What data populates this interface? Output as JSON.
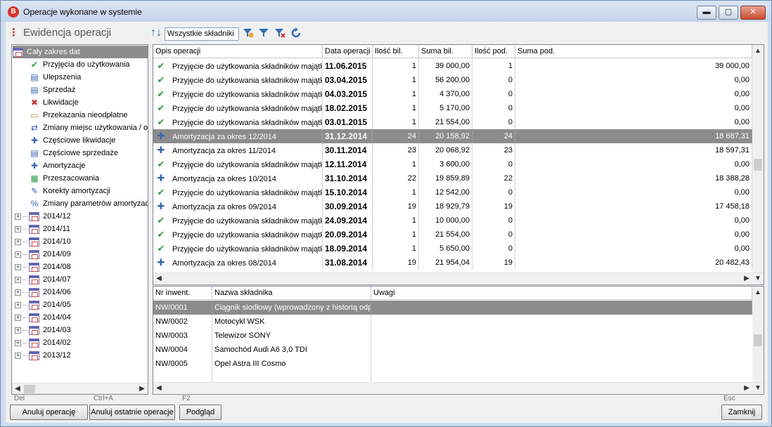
{
  "window": {
    "title": "Operacje wykonane w systemie",
    "app_badge": "B",
    "controls": {
      "minimize": "▬",
      "maximize": "▢",
      "close": "✕"
    }
  },
  "module": {
    "dots": "⋮",
    "title": "Ewidencja operacji"
  },
  "toolbar": {
    "sort_icon": "↑↓",
    "filter_value": "Wszystkie składniki",
    "icons": [
      "filter-settings-icon",
      "filter-icon",
      "filter-clear-icon",
      "refresh-icon"
    ]
  },
  "tree": {
    "root": "Cały zakres dat",
    "operations": [
      {
        "label": "Przyjęcia do użytkowania",
        "icon": "✔",
        "color": "#2e9b48"
      },
      {
        "label": "Ulepszenia",
        "icon": "▤",
        "color": "#3565b5"
      },
      {
        "label": "Sprzedaż",
        "icon": "▤",
        "color": "#3565b5"
      },
      {
        "label": "Likwidacje",
        "icon": "✖",
        "color": "#c9372c"
      },
      {
        "label": "Przekazania nieodpłatne",
        "icon": "▭",
        "color": "#c08a2a"
      },
      {
        "label": "Zmiany miejsc użytkowania / o",
        "icon": "⇄",
        "color": "#3565b5"
      },
      {
        "label": "Częściowe likwidacje",
        "icon": "✚",
        "color": "#3565b5"
      },
      {
        "label": "Częściowe sprzedaże",
        "icon": "▤",
        "color": "#3565b5"
      },
      {
        "label": "Amortyzacje",
        "icon": "✚",
        "color": "#3565b5"
      },
      {
        "label": "Przeszacowania",
        "icon": "▦",
        "color": "#2e9b48"
      },
      {
        "label": "Korekty amortyzacji",
        "icon": "✎",
        "color": "#3565b5"
      },
      {
        "label": "Zmiany parametrów amortyzacji",
        "icon": "%",
        "color": "#3565b5"
      }
    ],
    "periods": [
      "2014/12",
      "2014/11",
      "2014/10",
      "2014/09",
      "2014/08",
      "2014/07",
      "2014/06",
      "2014/05",
      "2014/04",
      "2014/03",
      "2014/02",
      "2013/12"
    ]
  },
  "ops_grid": {
    "headers": [
      "Opis operacji",
      "Data operacji",
      "Ilość bil.",
      "Suma bil.",
      "Ilość pod.",
      "Suma pod."
    ],
    "rows": [
      {
        "type": "check",
        "desc": "Przyjęcie do użytkowania składników majątku",
        "date": "11.06.2015",
        "qty_bil": "1",
        "sum_bil": "39 000,00",
        "qty_pod": "1",
        "sum_pod": "39 000,00"
      },
      {
        "type": "check",
        "desc": "Przyjęcie do użytkowania składników majątku",
        "date": "03.04.2015",
        "qty_bil": "1",
        "sum_bil": "56 200,00",
        "qty_pod": "0",
        "sum_pod": "0,00"
      },
      {
        "type": "check",
        "desc": "Przyjęcie do użytkowania składników majątku",
        "date": "04.03.2015",
        "qty_bil": "1",
        "sum_bil": "4 370,00",
        "qty_pod": "0",
        "sum_pod": "0,00"
      },
      {
        "type": "check",
        "desc": "Przyjęcie do użytkowania składników majątku",
        "date": "18.02.2015",
        "qty_bil": "1",
        "sum_bil": "5 170,00",
        "qty_pod": "0",
        "sum_pod": "0,00"
      },
      {
        "type": "check",
        "desc": "Przyjęcie do użytkowania składników majątku",
        "date": "03.01.2015",
        "qty_bil": "1",
        "sum_bil": "21 554,00",
        "qty_pod": "0",
        "sum_pod": "0,00"
      },
      {
        "type": "amort",
        "desc": "Amortyzacja za okres 12/2014",
        "date": "31.12.2014",
        "qty_bil": "24",
        "sum_bil": "20 158,92",
        "qty_pod": "24",
        "sum_pod": "18 687,31",
        "selected": true
      },
      {
        "type": "amort",
        "desc": "Amortyzacja za okres 11/2014",
        "date": "30.11.2014",
        "qty_bil": "23",
        "sum_bil": "20 068,92",
        "qty_pod": "23",
        "sum_pod": "18 597,31"
      },
      {
        "type": "check",
        "desc": "Przyjęcie do użytkowania składników majątku",
        "date": "12.11.2014",
        "qty_bil": "1",
        "sum_bil": "3 600,00",
        "qty_pod": "0",
        "sum_pod": "0,00"
      },
      {
        "type": "amort",
        "desc": "Amortyzacja za okres 10/2014",
        "date": "31.10.2014",
        "qty_bil": "22",
        "sum_bil": "19 859,89",
        "qty_pod": "22",
        "sum_pod": "18 388,28"
      },
      {
        "type": "check",
        "desc": "Przyjęcie do użytkowania składników majątku",
        "date": "15.10.2014",
        "qty_bil": "1",
        "sum_bil": "12 542,00",
        "qty_pod": "0",
        "sum_pod": "0,00"
      },
      {
        "type": "amort",
        "desc": "Amortyzacja za okres 09/2014",
        "date": "30.09.2014",
        "qty_bil": "19",
        "sum_bil": "18 929,79",
        "qty_pod": "19",
        "sum_pod": "17 458,18"
      },
      {
        "type": "check",
        "desc": "Przyjęcie do użytkowania składników majątku",
        "date": "24.09.2014",
        "qty_bil": "1",
        "sum_bil": "10 000,00",
        "qty_pod": "0",
        "sum_pod": "0,00"
      },
      {
        "type": "check",
        "desc": "Przyjęcie do użytkowania składników majątku",
        "date": "20.09.2014",
        "qty_bil": "1",
        "sum_bil": "21 554,00",
        "qty_pod": "0",
        "sum_pod": "0,00"
      },
      {
        "type": "check",
        "desc": "Przyjęcie do użytkowania składników majątku",
        "date": "18.09.2014",
        "qty_bil": "1",
        "sum_bil": "5 650,00",
        "qty_pod": "0",
        "sum_pod": "0,00"
      },
      {
        "type": "amort",
        "desc": "Amortyzacja za okres 08/2014",
        "date": "31.08.2014",
        "qty_bil": "19",
        "sum_bil": "21 954,04",
        "qty_pod": "19",
        "sum_pod": "20 482,43"
      }
    ]
  },
  "assets_grid": {
    "headers": [
      "Nr inwent.",
      "Nazwa składnika",
      "Uwagi"
    ],
    "rows": [
      {
        "nr": "NW/0001",
        "name": "Ciągnik siodłowy (wprowadzony z historią odpisów)",
        "note": "",
        "selected": true
      },
      {
        "nr": "NW/0002",
        "name": "Motocykl WSK",
        "note": ""
      },
      {
        "nr": "NW/0003",
        "name": "Telewizor SONY",
        "note": ""
      },
      {
        "nr": "NW/0004",
        "name": "Samochód Audi A6 3,0 TDI",
        "note": ""
      },
      {
        "nr": "NW/0005",
        "name": "Opel Astra III Cosmo",
        "note": ""
      }
    ]
  },
  "scroll_arrows": {
    "up": "▲",
    "down": "▼",
    "left": "◀",
    "right": "▶"
  },
  "footer": {
    "shortcuts": {
      "cancel": "Del",
      "cancel_last": "Ctrl+A",
      "preview": "F2",
      "close": "Esc"
    },
    "buttons": {
      "cancel": "Anuluj operację",
      "cancel_last": "Anuluj ostatnie operacje",
      "preview": "Podgląd",
      "close": "Zamknij"
    }
  }
}
